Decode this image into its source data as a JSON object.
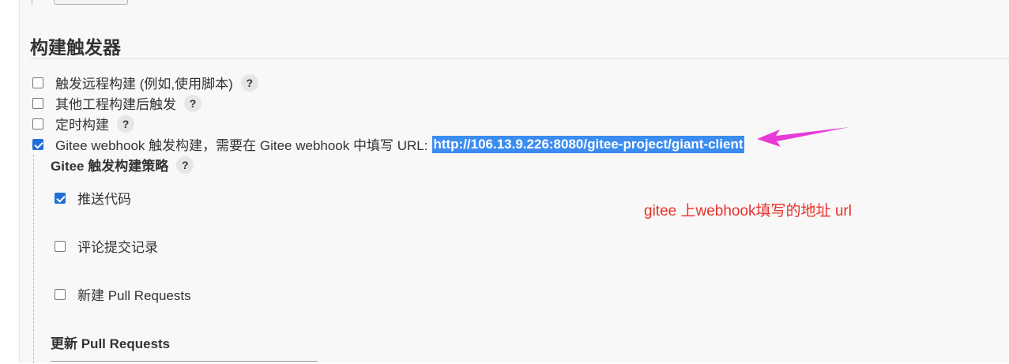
{
  "section": {
    "title": "构建触发器"
  },
  "triggers": [
    {
      "label": "触发远程构建 (例如,使用脚本)",
      "checked": false,
      "help": "?"
    },
    {
      "label": "其他工程构建后触发",
      "checked": false,
      "help": "?"
    },
    {
      "label": "定时构建",
      "checked": false,
      "help": "?"
    },
    {
      "label": "Gitee webhook 触发构建，需要在 Gitee webhook 中填写 URL:",
      "url": "http://106.13.9.226:8080/gitee-project/giant-client",
      "checked": true
    }
  ],
  "strategy": {
    "title": "Gitee 触发构建策略",
    "help": "?",
    "options": [
      {
        "label": "推送代码",
        "checked": true
      },
      {
        "label": "评论提交记录",
        "checked": false
      },
      {
        "label": "新建 Pull Requests",
        "checked": false
      }
    ]
  },
  "update_pr": {
    "title": "更新 Pull Requests"
  },
  "annotation": {
    "text": "gitee 上webhook填写的地址 url",
    "color": "#e8302a",
    "arrow_color": "#e83ad6"
  }
}
